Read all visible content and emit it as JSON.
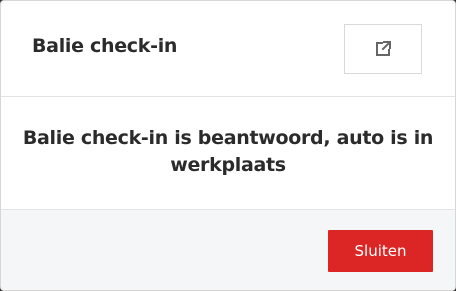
{
  "modal": {
    "title": "Balie check-in",
    "message": "Balie check-in is beantwoord, auto is in werkplaats",
    "open_external_icon": "external-link-icon",
    "close_label": "Sluiten"
  },
  "colors": {
    "primary_button": "#dc2626",
    "footer_background": "#f5f6f8",
    "text": "#2b2b2b"
  }
}
